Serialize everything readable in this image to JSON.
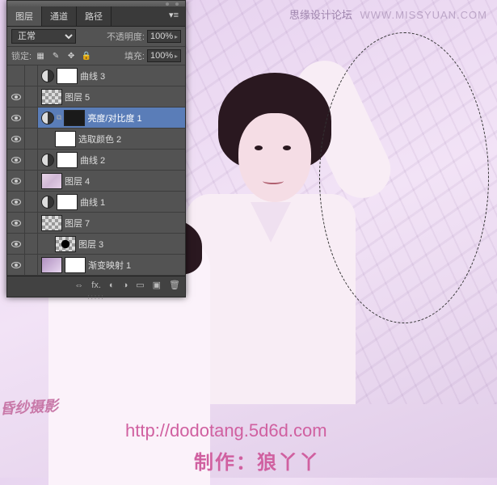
{
  "watermark": {
    "top_left": "思缘设计论坛",
    "top_right": "WWW.MISSYUAN.COM",
    "left_text": "昏纱摄影",
    "url": "http://dodotang.5d6d.com",
    "credit": "制作：狼丫丫"
  },
  "panel": {
    "tabs": {
      "layers": "图层",
      "channels": "通道",
      "paths": "路径"
    },
    "blend_mode": "正常",
    "opacity_label": "不透明度:",
    "opacity_value": "100%",
    "lock_label": "锁定:",
    "fill_label": "填充:",
    "fill_value": "100%"
  },
  "layers": [
    {
      "name": "曲线 3"
    },
    {
      "name": "图层 5"
    },
    {
      "name": "亮度/对比度 1"
    },
    {
      "name": "选取颜色 2"
    },
    {
      "name": "曲线 2"
    },
    {
      "name": "图层 4"
    },
    {
      "name": "曲线 1"
    },
    {
      "name": "图层 7"
    },
    {
      "name": "图层 3"
    },
    {
      "name": "渐变映射 1"
    }
  ],
  "footer": {
    "fx": "fx."
  }
}
